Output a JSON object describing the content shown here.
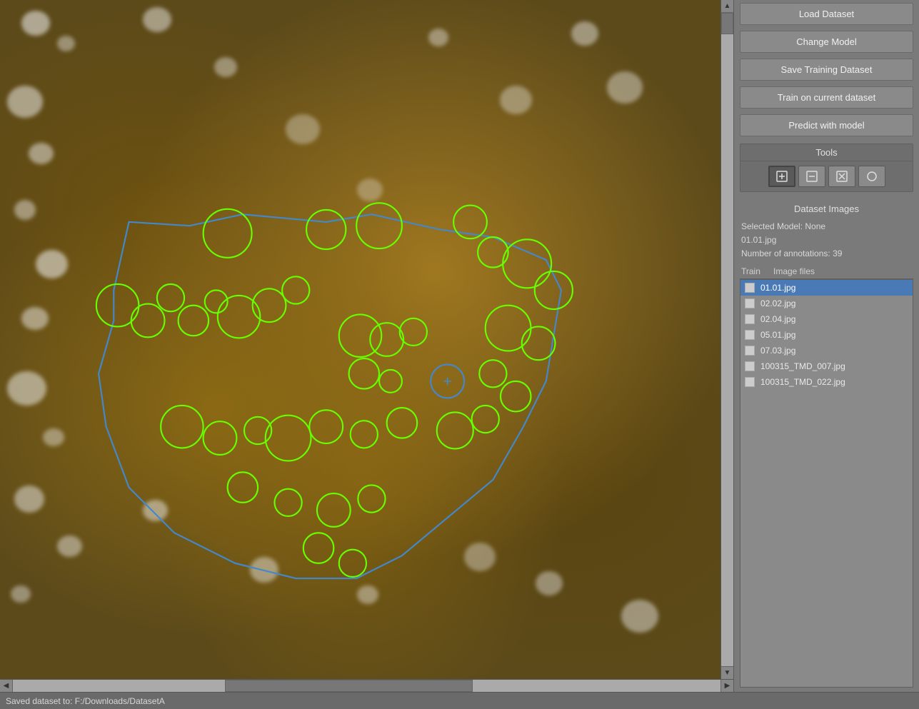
{
  "buttons": {
    "load_dataset": "Load Dataset",
    "change_model": "Change Model",
    "save_training": "Save Training Dataset",
    "train_current": "Train on current dataset",
    "predict_model": "Predict with model"
  },
  "tools": {
    "label": "Tools",
    "tool_add": "+",
    "tool_remove": "−",
    "tool_clear": "×",
    "tool_circle": "○"
  },
  "dataset": {
    "title": "Dataset Images",
    "selected_model_label": "Selected Model: None",
    "current_file": "01.01.jpg",
    "annotations_label": "Number of annotations: 39",
    "column_train": "Train",
    "column_files": "Image files"
  },
  "files": [
    {
      "name": "01.01.jpg",
      "checked": false,
      "selected": true
    },
    {
      "name": "02.02.jpg",
      "checked": false,
      "selected": false
    },
    {
      "name": "02.04.jpg",
      "checked": false,
      "selected": false
    },
    {
      "name": "05.01.jpg",
      "checked": false,
      "selected": false
    },
    {
      "name": "07.03.jpg",
      "checked": false,
      "selected": false
    },
    {
      "name": "100315_TMD_007.jpg",
      "checked": false,
      "selected": false
    },
    {
      "name": "100315_TMD_022.jpg",
      "checked": false,
      "selected": false
    }
  ],
  "status_bar": {
    "text": "Saved dataset to: F:/Downloads/DatasetA"
  },
  "scrollbar": {
    "up_arrow": "▲",
    "down_arrow": "▼",
    "left_arrow": "◀",
    "right_arrow": "▶"
  }
}
